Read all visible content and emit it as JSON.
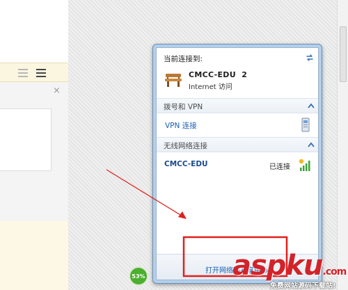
{
  "doc": {
    "close_glyph": "×"
  },
  "flyout": {
    "header": "当前连接到:",
    "connected_network": {
      "name": "CMCC-EDU  2",
      "status": "Internet 访问"
    },
    "dialup_section": {
      "label": "拨号和 VPN",
      "items": [
        {
          "name": "VPN 连接"
        }
      ]
    },
    "wireless_section": {
      "label": "无线网络连接",
      "items": [
        {
          "name": "CMCC-EDU",
          "status": "已连接"
        }
      ]
    },
    "footer_link": "打开网络和共享中心"
  },
  "taskbar": {
    "badge": "53%"
  },
  "watermark": {
    "brand": "aspku",
    "tld": ".com",
    "subtitle": "免费网站源码下载站!"
  },
  "colors": {
    "annotation_red": "#e0201c",
    "link_blue": "#1a5fb4",
    "badge_green": "#4caf2e",
    "doc_toolbar": "#fbf6df"
  },
  "icons": [
    "list-icon",
    "bulleted-list-icon",
    "close-icon",
    "refresh-icon",
    "bench-network-icon",
    "chevron-up-icon",
    "vpn-device-icon",
    "wifi-signal-icon"
  ]
}
